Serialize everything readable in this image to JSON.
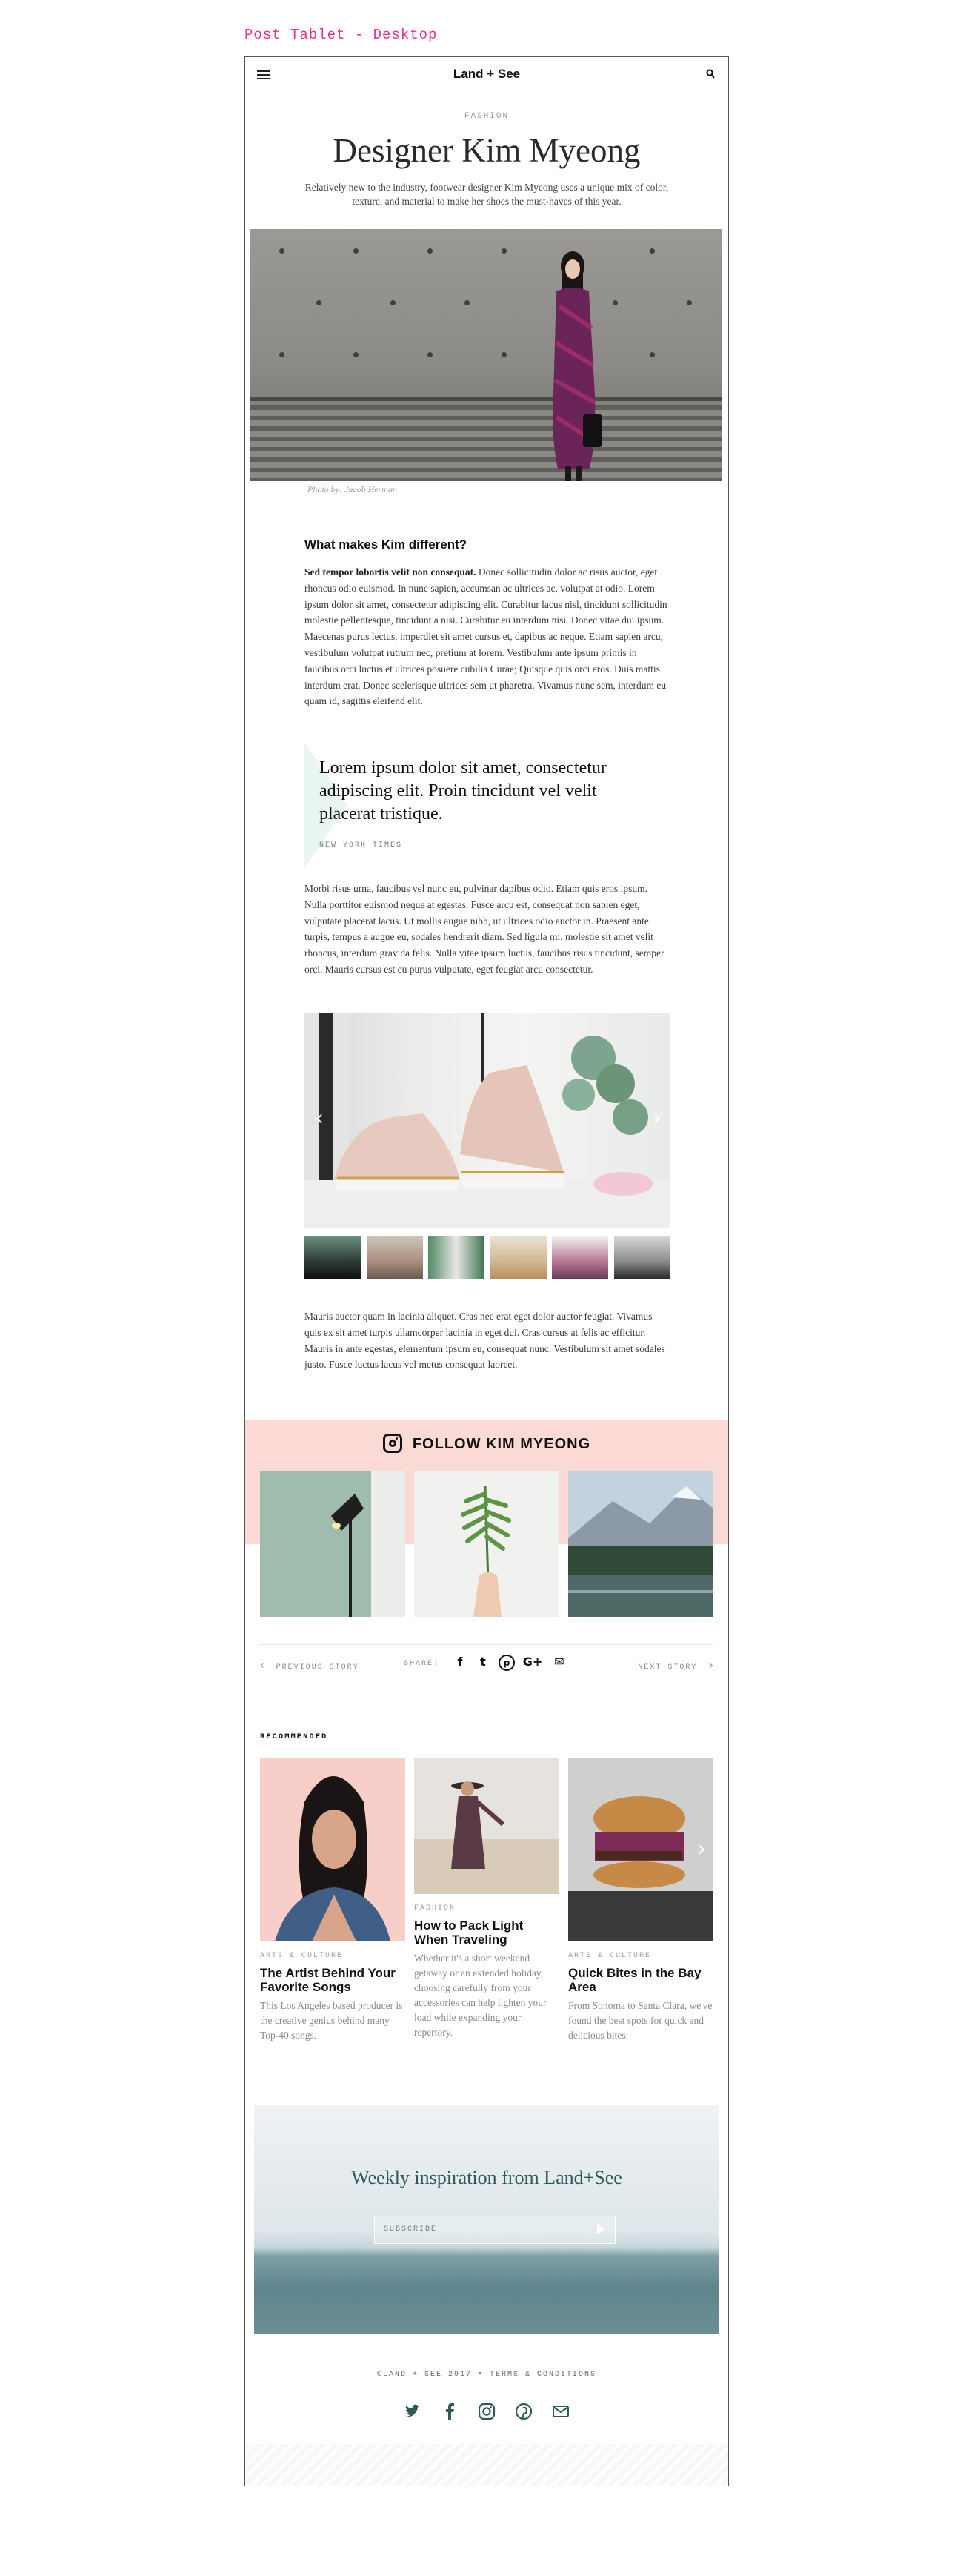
{
  "page_label": "Post Tablet - Desktop",
  "header": {
    "brand": "Land + See",
    "menu_icon": "hamburger-menu-icon",
    "search_icon": "search-icon"
  },
  "article": {
    "category": "FASHION",
    "title": "Designer Kim Myeong",
    "subtitle": "Relatively new to the industry, footwear designer Kim Myeong uses a unique mix of color, texture, and material to make her shoes the must-haves of this year.",
    "photo_caption": "Photo by: Jacob Herman",
    "section_heading": "What makes Kim different?",
    "body1_lead": "Sed tempor lobortis velit non consequat.",
    "body1_text": "Donec sollicitudin dolor ac risus auctor, eget rhoncus odio euismod. In nunc sapien, accumsan ac ultrices ac, volutpat at odio. Lorem ipsum dolor sit amet, consectetur adipiscing elit. Curabitur lacus nisl, tincidunt sollicitudin molestie pellentesque, tincidunt a nisi. Curabitur eu interdum nisi. Donec vitae dui ipsum. Maecenas purus lectus, imperdiet sit amet cursus et, dapibus ac neque. Etiam sapien arcu, vestibulum volutpat rutrum nec, pretium at lorem. Vestibulum ante ipsum primis in faucibus orci luctus et ultrices posuere cubilia Curae; Quisque quis orci eros. Duis mattis interdum erat. Donec scelerisque ultrices sem ut pharetra. Vivamus nunc sem, interdum eu quam id, sagittis eleifend elit.",
    "pull_quote": "Lorem ipsum dolor sit amet, consectetur adipiscing elit. Proin tincidunt vel velit placerat tristique.",
    "quote_source": "NEW YORK TIMES",
    "body2": "Morbi risus urna, faucibus vel nunc eu, pulvinar dapibus odio. Etiam quis eros ipsum. Nulla porttitor euismod neque at egestas. Fusce arcu est, consequat non sapien eget, vulputate placerat lacus. Ut mollis augue nibh, ut ultrices odio auctor in. Praesent ante turpis, tempus a augue eu, sodales hendrerit diam. Sed ligula mi, molestie sit amet velit rhoncus, interdum gravida felis. Nulla vitae ipsum luctus, faucibus risus tincidunt, semper orci. Mauris cursus est eu purus vulputate, eget feugiat arcu consectetur.",
    "body3": "Mauris auctor quam in lacinia aliquet. Cras nec erat eget dolor auctor feugiat. Vivamus quis ex sit amet turpis ullamcorper lacinia in eget dui. Cras cursus at felis ac efficitur. Mauris in ante egestas, elementum ipsum eu, consequat nunc. Vestibulum sit amet sodales justo. Fusce luctus lacus vel metus consequat laoreet."
  },
  "gallery": {
    "prev_icon": "chevron-left-icon",
    "next_icon": "chevron-right-icon",
    "thumb_count": 6
  },
  "follow": {
    "title": "FOLLOW KIM MYEONG",
    "icon": "instagram-icon"
  },
  "share_bar": {
    "previous": "PREVIOUS STORY",
    "next": "NEXT STORY",
    "share_label": "SHARE:",
    "icons": [
      "facebook-icon",
      "twitter-icon",
      "pinterest-icon",
      "google-plus-icon",
      "mail-icon"
    ],
    "glyphs": [
      "f",
      "t",
      "p",
      "G+",
      "✉"
    ]
  },
  "recommended": {
    "label": "RECOMMENDED",
    "cards": [
      {
        "category": "ARTS & CULTURE",
        "title": "The Artist Behind Your Favorite Songs",
        "desc": "This Los Angeles based producer is the creative genius behind many Top-40 songs."
      },
      {
        "category": "FASHION",
        "title": "How to Pack Light When Traveling",
        "desc": "Whether it's a short weekend getaway or an extended holiday, choosing carefully from your accessories can help lighten your load while expanding your repertory."
      },
      {
        "category": "ARTS & CULTURE",
        "title": "Quick Bites in the Bay Area",
        "desc": "From Sonoma to Santa Clara, we've found the best spots for quick and delicious bites."
      }
    ]
  },
  "newsletter": {
    "title": "Weekly inspiration from Land+See",
    "placeholder": "SUBSCRIBE"
  },
  "footer": {
    "copyright": "©LAND + SEE 2017  •  TERMS & CONDITIONS",
    "icons": [
      "twitter-icon",
      "facebook-icon",
      "instagram-icon",
      "pinterest-icon",
      "mail-icon"
    ]
  },
  "colors": {
    "accent_pink": "#e0338f",
    "follow_band": "#fbd9d4",
    "quote_tint": "#e9f5f2",
    "newsletter_text": "#2f5a56"
  }
}
